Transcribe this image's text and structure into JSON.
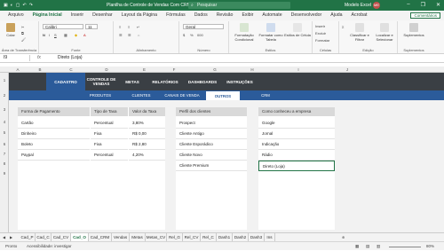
{
  "window": {
    "title": "Planilha de Controle de Vendas Com CRM 4.0",
    "search_placeholder": "Pesquisar",
    "account_name": "Modelo Excel",
    "avatar_initials": "ME"
  },
  "ribbon_tabs": [
    "Arquivo",
    "Página Inicial",
    "Inserir",
    "Desenhar",
    "Layout da Página",
    "Fórmulas",
    "Dados",
    "Revisão",
    "Exibir",
    "Automate",
    "Desenvolvedor",
    "Ajuda",
    "Acrobat"
  ],
  "ribbon_active_tab": "Página Inicial",
  "share_button": "Comentários",
  "ribbon": {
    "clipboard": {
      "paste": "Colar",
      "group": "Área de Transferência"
    },
    "font": {
      "name": "Calibri",
      "size": "11",
      "group": "Fonte"
    },
    "alignment": {
      "group": "Alinhamento"
    },
    "number": {
      "format": "Geral",
      "group": "Número"
    },
    "styles": {
      "conditional": "Formatação Condicional",
      "table": "Formatar como Tabela",
      "cell": "Estilos de Célula",
      "group": "Estilos"
    },
    "cells": {
      "insert": "Inserir",
      "delete": "Excluir",
      "format": "Formatar",
      "group": "Células"
    },
    "editing": {
      "sort": "Classificar e Filtrar",
      "find": "Localizar e Selecionar",
      "group": "Edição"
    },
    "addins": {
      "label": "Suplementos",
      "group": "Suplementos"
    }
  },
  "formula_bar": {
    "name_box": "I9",
    "fx": "fx",
    "content": "Direto (Loja)"
  },
  "columns": [
    "A",
    "B",
    "C",
    "D",
    "E",
    "F",
    "G",
    "H",
    "I",
    "J"
  ],
  "rows": [
    "1",
    "2",
    "3",
    "4",
    "5",
    "6",
    "7",
    "8",
    "9"
  ],
  "nav_primary": [
    "CADASTRO",
    "CONTROLE DE VENDAS",
    "METAS",
    "RELATÓRIOS",
    "DASHBOARDS",
    "INSTRUÇÕES"
  ],
  "nav_primary_active": "CADASTRO",
  "nav_secondary": [
    "PRODUTOS",
    "CLIENTES",
    "CANAIS DE VENDA",
    "OUTROS",
    "CRM"
  ],
  "nav_secondary_active": "OUTROS",
  "panels": {
    "payment": {
      "headers": [
        "Forma de Pagamento",
        "Tipo de Taxa",
        "Valor da Taxa"
      ],
      "rows": [
        [
          "Cartão",
          "Percentual",
          "3,80%"
        ],
        [
          "Dinheiro",
          "Fixa",
          "R$ 0,00"
        ],
        [
          "Boleto",
          "Fixa",
          "R$ 2,80"
        ],
        [
          "Paypal",
          "Percentual",
          "4,20%"
        ]
      ]
    },
    "profiles": {
      "header": "Perfil dos clientes",
      "items": [
        "Prospect",
        "Cliente Antigo",
        "Cliente Esporádico",
        "Cliente Novo",
        "Cliente Premium"
      ]
    },
    "sources": {
      "header": "Como conheceu a empresa",
      "items": [
        "Google",
        "Jornal",
        "Indicação",
        "Rádio",
        "Direto (Loja)"
      ]
    }
  },
  "sheet_tabs": [
    "Cad_P",
    "Cad_C",
    "Cad_CV",
    "Cad_O",
    "Cad_CRM",
    "Vendas",
    "Metas",
    "Metas_CV",
    "Rel_G",
    "Rel_CV",
    "Rel_C",
    "Dash1",
    "Dash2",
    "Dash3",
    "Ins"
  ],
  "sheet_active": "Cad_O",
  "status": {
    "ready": "Pronto",
    "accessibility": "Acessibilidade: investigar",
    "zoom": "80%"
  }
}
